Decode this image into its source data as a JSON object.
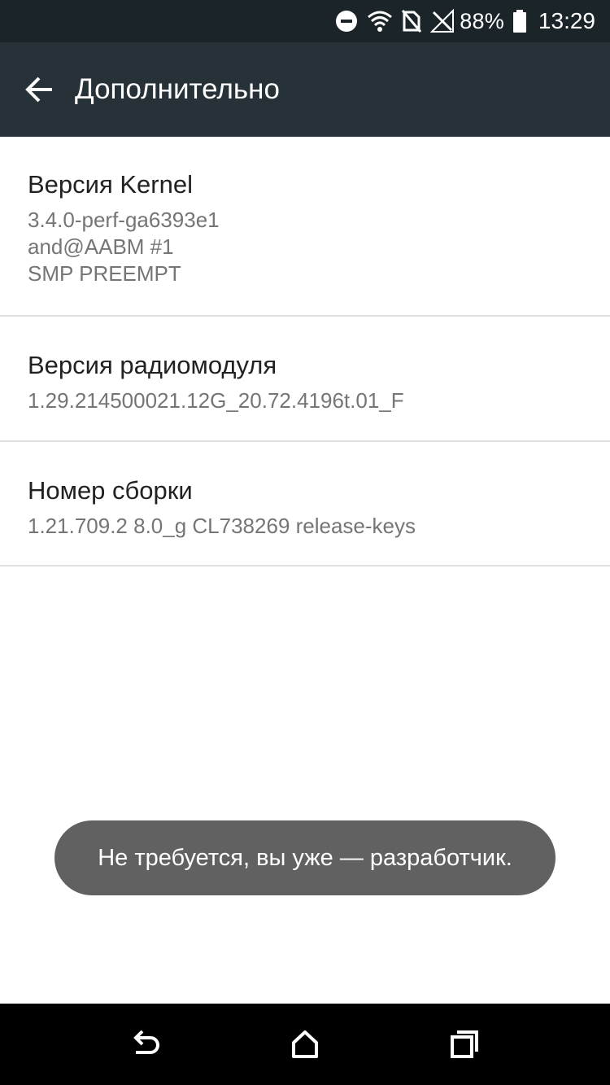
{
  "status_bar": {
    "battery": "88%",
    "time": "13:29",
    "icons": [
      "dnd-icon",
      "wifi-icon",
      "no-sim-icon",
      "signal-icon",
      "battery-icon"
    ]
  },
  "app_bar": {
    "title": "Дополнительно",
    "back_icon": "arrow-back-icon"
  },
  "items": [
    {
      "title": "Версия Kernel",
      "summary": "3.4.0-perf-ga6393e1\nand@AABM #1\nSMP PREEMPT"
    },
    {
      "title": "Версия радиомодуля",
      "summary": "1.29.214500021.12G_20.72.4196t.01_F"
    },
    {
      "title": "Номер сборки",
      "summary": "1.21.709.2 8.0_g CL738269 release-keys"
    }
  ],
  "toast": {
    "message": "Не требуется, вы уже — разработчик."
  },
  "nav_bar": {
    "icons": [
      "back-icon",
      "home-icon",
      "recents-icon"
    ]
  },
  "colors": {
    "status_bar": "#1b2429",
    "app_bar": "#263238",
    "toast": "#616161",
    "nav_bar": "#000000"
  }
}
